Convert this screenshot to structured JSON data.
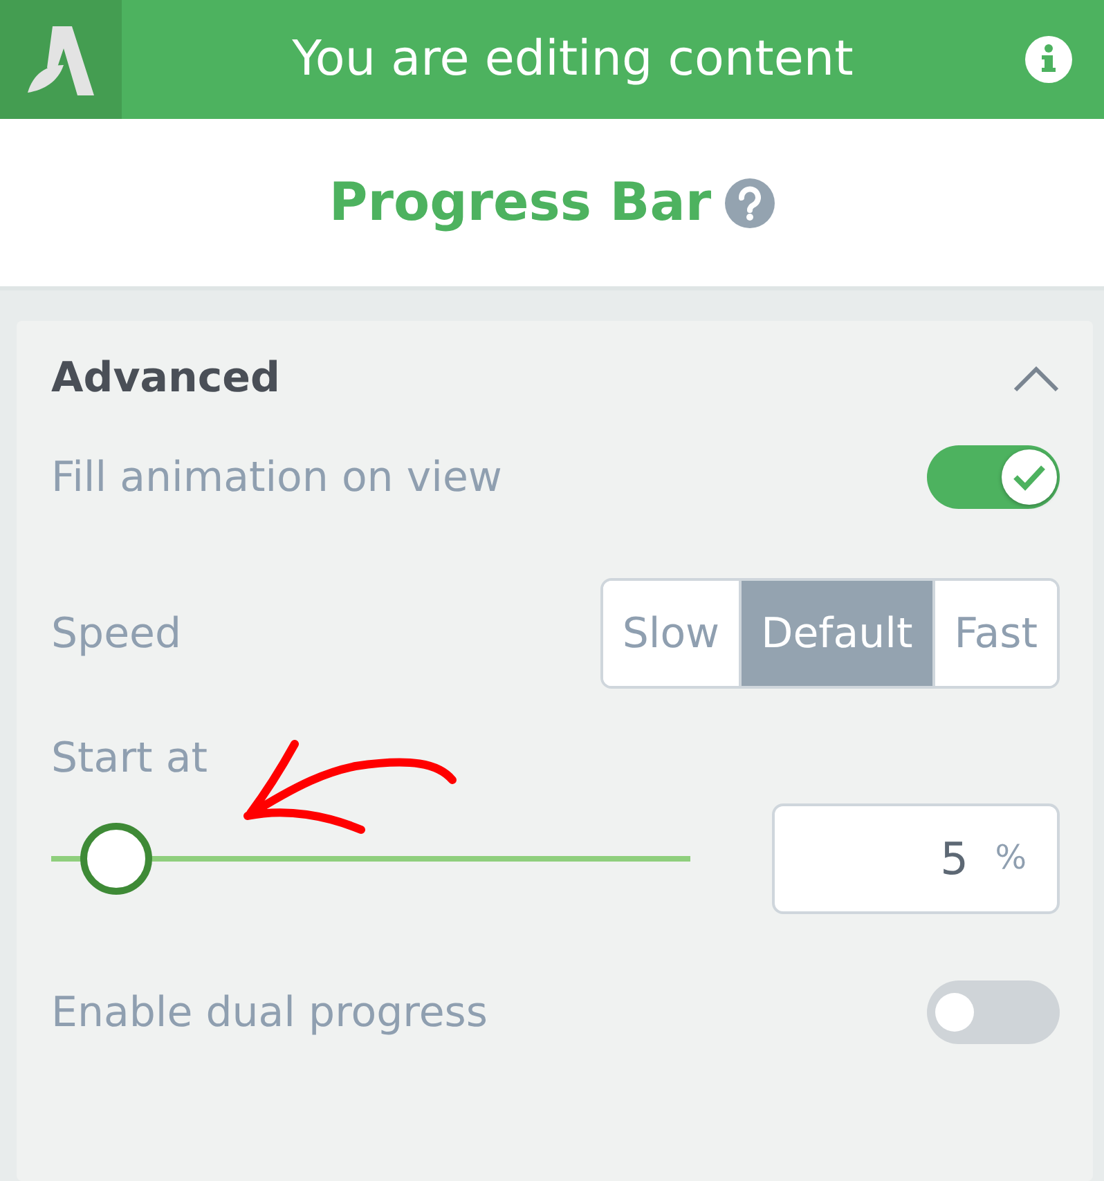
{
  "header": {
    "title": "You are editing content"
  },
  "block": {
    "title": "Progress Bar"
  },
  "section": {
    "title": "Advanced",
    "expanded": true,
    "settings": [
      {
        "kind": "toggle",
        "label": "Fill animation on view",
        "on": true
      },
      {
        "kind": "segmented",
        "label": "Speed",
        "options": [
          {
            "label": "Slow",
            "selected": false
          },
          {
            "label": "Default",
            "selected": true
          },
          {
            "label": "Fast",
            "selected": false
          }
        ]
      },
      {
        "kind": "slider",
        "label": "Start at",
        "level": 0.05,
        "value": "5",
        "unit": "%"
      },
      {
        "kind": "toggle",
        "label": "Enable dual progress",
        "on": false
      }
    ]
  }
}
